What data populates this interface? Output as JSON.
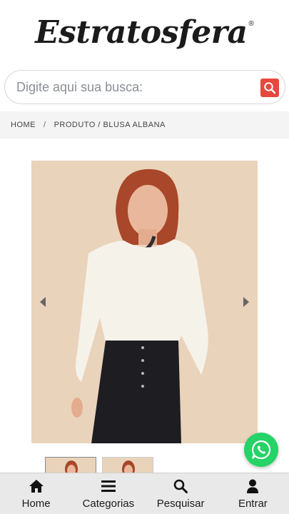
{
  "header": {
    "logo_text": "Estratosfera",
    "logo_registered": "®"
  },
  "search": {
    "placeholder": "Digite aqui sua busca:"
  },
  "breadcrumb": {
    "items": [
      "HOME",
      "PRODUTO / BLUSA ALBANA"
    ],
    "separator": "/"
  },
  "product": {
    "image_alt": "BLUSA ALBANA"
  },
  "bottom_nav": {
    "items": [
      {
        "label": "Home",
        "icon": "home-icon"
      },
      {
        "label": "Categorias",
        "icon": "menu-icon"
      },
      {
        "label": "Pesquisar",
        "icon": "search-icon"
      },
      {
        "label": "Entrar",
        "icon": "user-icon"
      }
    ]
  },
  "colors": {
    "accent": "#e8473d",
    "whatsapp": "#25d366",
    "nav_bg": "#e9e9e9",
    "breadcrumb_bg": "#f4f4f4"
  }
}
